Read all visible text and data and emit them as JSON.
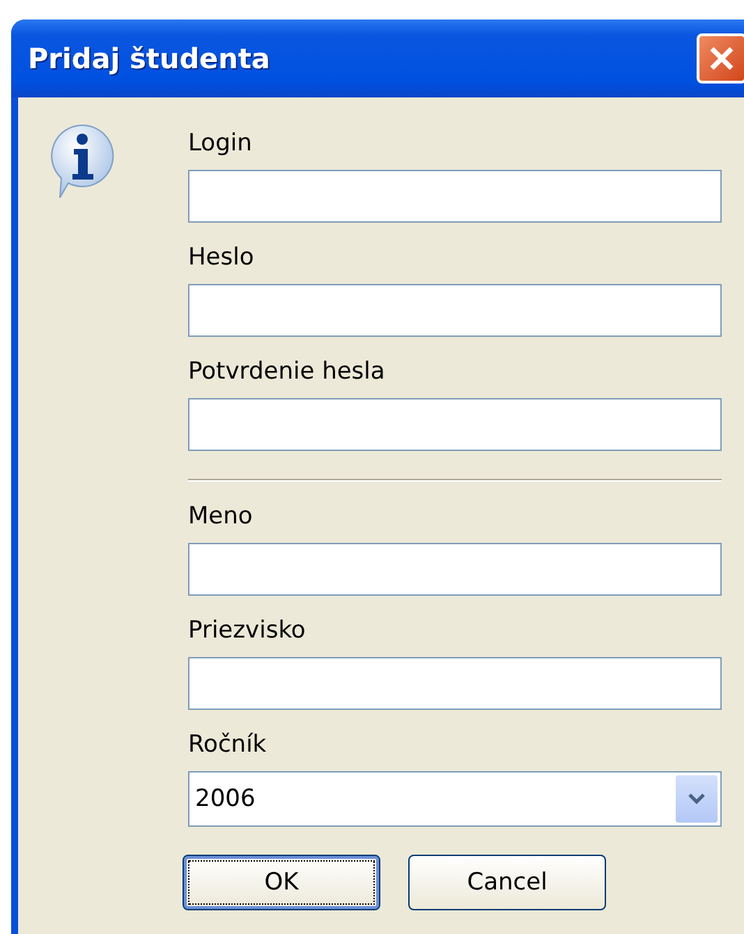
{
  "window": {
    "title": "Pridaj študenta"
  },
  "groups": [
    [
      {
        "kind": "text",
        "label": "Login"
      },
      {
        "kind": "text",
        "label": "Heslo"
      },
      {
        "kind": "text",
        "label": "Potvrdenie hesla"
      }
    ],
    [
      {
        "kind": "text",
        "label": "Meno"
      },
      {
        "kind": "text",
        "label": "Priezvisko"
      },
      {
        "kind": "select",
        "label": "Ročník",
        "value": "2006"
      }
    ]
  ],
  "buttons": [
    {
      "label": "OK",
      "default": true
    },
    {
      "label": "Cancel",
      "default": false
    }
  ]
}
